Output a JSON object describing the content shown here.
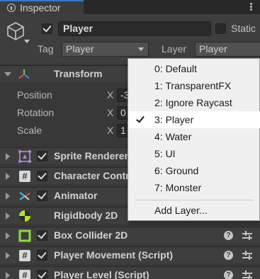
{
  "window": {
    "tab_title": "Inspector"
  },
  "gameobject": {
    "active": true,
    "name": "Player",
    "static_label": "Static",
    "static": false,
    "tag_label": "Tag",
    "tag_value": "Player",
    "layer_label": "Layer",
    "layer_value": "Player"
  },
  "transform": {
    "name": "Transform",
    "rows": [
      {
        "label": "Position",
        "axis": "X",
        "value": "-3"
      },
      {
        "label": "Rotation",
        "axis": "X",
        "value": "0"
      },
      {
        "label": "Scale",
        "axis": "X",
        "value": "1"
      }
    ]
  },
  "components": [
    {
      "name": "Sprite Renderer",
      "icon": "sprite-renderer-icon",
      "enabled": true
    },
    {
      "name": "Character Controller",
      "icon": "script-icon",
      "enabled": true
    },
    {
      "name": "Animator",
      "icon": "animator-icon",
      "enabled": true
    },
    {
      "name": "Rigidbody 2D",
      "icon": "rigidbody-icon",
      "enabled": false
    },
    {
      "name": "Box Collider 2D",
      "icon": "box-collider-icon",
      "enabled": true
    },
    {
      "name": "Player Movement (Script)",
      "icon": "script-icon",
      "enabled": true
    },
    {
      "name": "Player Level (Script)",
      "icon": "script-icon",
      "enabled": true
    }
  ],
  "layer_menu": {
    "items": [
      {
        "label": "0: Default",
        "checked": false
      },
      {
        "label": "1: TransparentFX",
        "checked": false
      },
      {
        "label": "2: Ignore Raycast",
        "checked": false
      },
      {
        "label": "3: Player",
        "checked": true
      },
      {
        "label": "4: Water",
        "checked": false
      },
      {
        "label": "5: UI",
        "checked": false
      },
      {
        "label": "6: Ground",
        "checked": false
      },
      {
        "label": "7: Monster",
        "checked": false
      }
    ],
    "add_layer_label": "Add Layer..."
  },
  "icons": {
    "help": "help-icon",
    "presets": "presets-icon",
    "menu": "more-options-icon"
  },
  "help_glyph": "?",
  "script_glyph": "#",
  "colors": {
    "accent": "#3a79bb",
    "panel": "#383838",
    "header": "#3e3e3e",
    "popup_bg": "#f0f0f0",
    "transform_icon_red": "#e0504a",
    "transform_icon_green": "#7ac943",
    "transform_icon_blue": "#4a7fe0",
    "rigidbody_green": "#b5e61d",
    "collider_green": "#8fdb3c",
    "animator_cyan": "#43c3d8"
  }
}
